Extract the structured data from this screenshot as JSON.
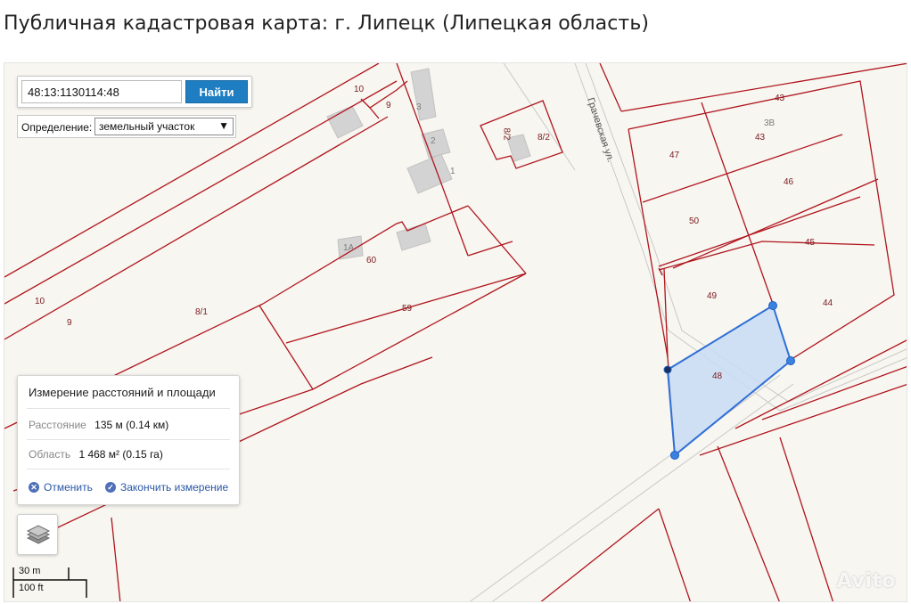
{
  "page": {
    "title": "Публичная кадастровая карта: г. Липецк (Липецкая область)"
  },
  "search": {
    "value": "48:13:1130114:48",
    "button_label": "Найти"
  },
  "definition": {
    "label": "Определение:",
    "selected": "земельный участок"
  },
  "map": {
    "street_label": "Грачевская ул.",
    "parcel_labels": [
      "10",
      "9",
      "3",
      "2",
      "1",
      "8/2",
      "8/2",
      "1А",
      "60",
      "59",
      "10",
      "9",
      "8/1",
      "43",
      "3В",
      "43",
      "47",
      "46",
      "50",
      "45",
      "49",
      "44",
      "48"
    ]
  },
  "measurement": {
    "title": "Измерение расстояний и площади",
    "distance_label": "Расстояние",
    "distance_value": "135 м (0.14 км)",
    "area_label": "Область",
    "area_value": "1 468 м² (0.15 га)",
    "cancel_label": "Отменить",
    "finish_label": "Закончить измерение"
  },
  "scale": {
    "metric": "30 m",
    "imperial": "100 ft"
  },
  "watermark": "Avito",
  "colors": {
    "parcel_line": "#b0151e",
    "accent": "#1f7ec1",
    "polygon_fill": "#c9dcf5",
    "polygon_stroke": "#2f6fd6"
  },
  "icons": {
    "cancel": "x-circle-icon",
    "finish": "check-circle-icon",
    "layers": "layers-icon"
  }
}
